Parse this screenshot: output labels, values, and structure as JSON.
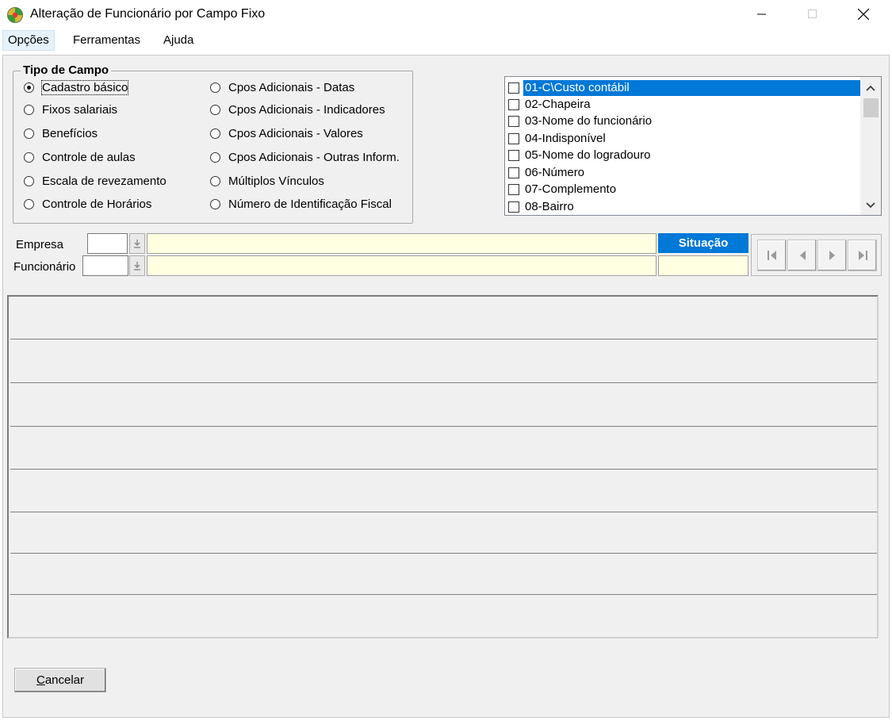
{
  "window": {
    "title": "Alteração de Funcionário por Campo Fixo"
  },
  "menu": {
    "opcoes": "Opções",
    "ferramentas": "Ferramentas",
    "ajuda": "Ajuda"
  },
  "tipo_campo": {
    "legend": "Tipo de Campo",
    "selected": "Cadastro básico",
    "left_options": [
      "Cadastro básico",
      "Fixos salariais",
      "Benefícios",
      "Controle de aulas",
      "Escala de revezamento",
      "Controle de Horários"
    ],
    "right_options": [
      "Cpos Adicionais - Datas",
      "Cpos Adicionais - Indicadores",
      "Cpos Adicionais - Valores",
      "Cpos Adicionais - Outras Inform.",
      "Múltiplos Vínculos",
      "Número de Identificação Fiscal"
    ]
  },
  "field_list": {
    "selected_index": 0,
    "items": [
      "01-C\\Custo contábil",
      "02-Chapeira",
      "03-Nome do funcionário",
      "04-Indisponível",
      "05-Nome do logradouro",
      "06-Número",
      "07-Complemento",
      "08-Bairro"
    ]
  },
  "filters": {
    "empresa_label": "Empresa",
    "empresa_code": "",
    "empresa_name": "",
    "funcionario_label": "Funcionário",
    "funcionario_code": "",
    "funcionario_name": "",
    "situacao_header": "Situação",
    "situacao_value": ""
  },
  "grid": {
    "rows": [
      "",
      "",
      "",
      "",
      "",
      "",
      "",
      ""
    ]
  },
  "buttons": {
    "cancelar_accel": "C",
    "cancelar_rest": "ancelar"
  },
  "colors": {
    "accent": "#0078d7",
    "readonly_field": "#ffffe1",
    "client_bg": "#f0f0f0"
  }
}
